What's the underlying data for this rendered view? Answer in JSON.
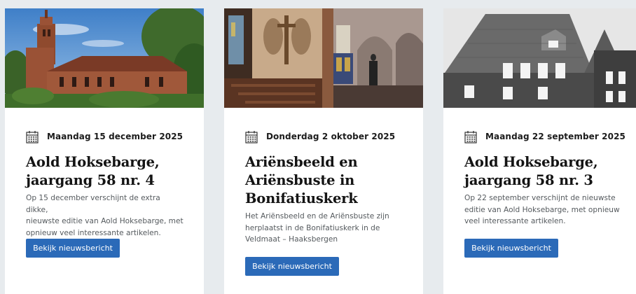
{
  "cards": [
    {
      "date": "Maandag 15 december 2025",
      "title_lines": [
        "Aold Hoksebarge,",
        "jaargang 58 nr. 4"
      ],
      "desc_lines": [
        "Op 15 december verschijnt de extra dikke,",
        "nieuwste editie van Aold Hoksebarge, met",
        "opnieuw veel interessante artikelen."
      ],
      "button": "Bekijk nieuwsbericht",
      "image": "church-exterior-photo"
    },
    {
      "date": "Donderdag 2 oktober 2025",
      "title_lines": [
        "Ariënsbeeld en",
        "Ariënsbuste in",
        "Bonifatiuskerk"
      ],
      "desc_lines": [
        "Het Ariënsbeeld en de Ariënsbuste zijn",
        "herplaatst in de Bonifatiuskerk in de",
        "Veldmaat – Haaksbergen"
      ],
      "button": "Bekijk nieuwsbericht",
      "image": "church-interior-photo"
    },
    {
      "date": "Maandag 22 september 2025",
      "title_lines": [
        "Aold Hoksebarge,",
        "jaargang 58 nr. 3"
      ],
      "desc_lines": [
        "Op 22 september verschijnt de nieuwste",
        "editie van Aold Hoksebarge, met opnieuw",
        "veel interessante artikelen."
      ],
      "button": "Bekijk nieuwsbericht",
      "image": "building-bw-photo"
    }
  ],
  "icons": {
    "date": "calendar-icon"
  },
  "colors": {
    "button": "#2b6ab8",
    "page_bg": "#e7ebee",
    "card_bg": "#ffffff"
  }
}
